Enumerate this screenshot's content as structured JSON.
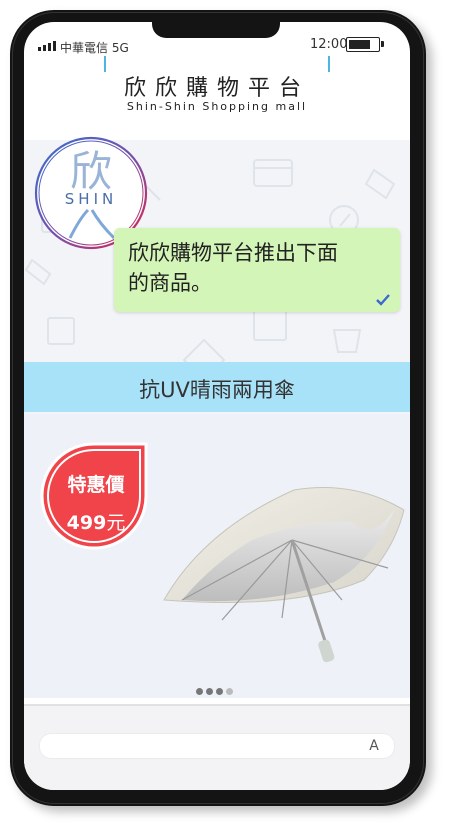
{
  "status_bar": {
    "carrier": "中華電信 5G",
    "time": "12:00",
    "battery_level": 0.8
  },
  "header": {
    "title": "欣欣購物平台",
    "subtitle": "Shin-Shin Shopping mall"
  },
  "logo": {
    "glyph": "欣",
    "text": "SHIN"
  },
  "chat": {
    "message_line1": "欣欣購物平台推出下面",
    "message_line2": "的商品。",
    "read_icon": "check-icon"
  },
  "product": {
    "name": "抗UV晴雨兩用傘",
    "price_label": "特惠價",
    "price_amount": "499",
    "price_unit": "元",
    "image_icon": "umbrella-icon"
  },
  "carousel": {
    "total": 4,
    "active_index": 0
  },
  "composer": {
    "input_value": "",
    "font_button": "A"
  },
  "colors": {
    "accent": "#4ab5e0",
    "bubble": "#d4f5b8",
    "product_band": "#a8e2f8",
    "price_tag": "#f0434a"
  }
}
